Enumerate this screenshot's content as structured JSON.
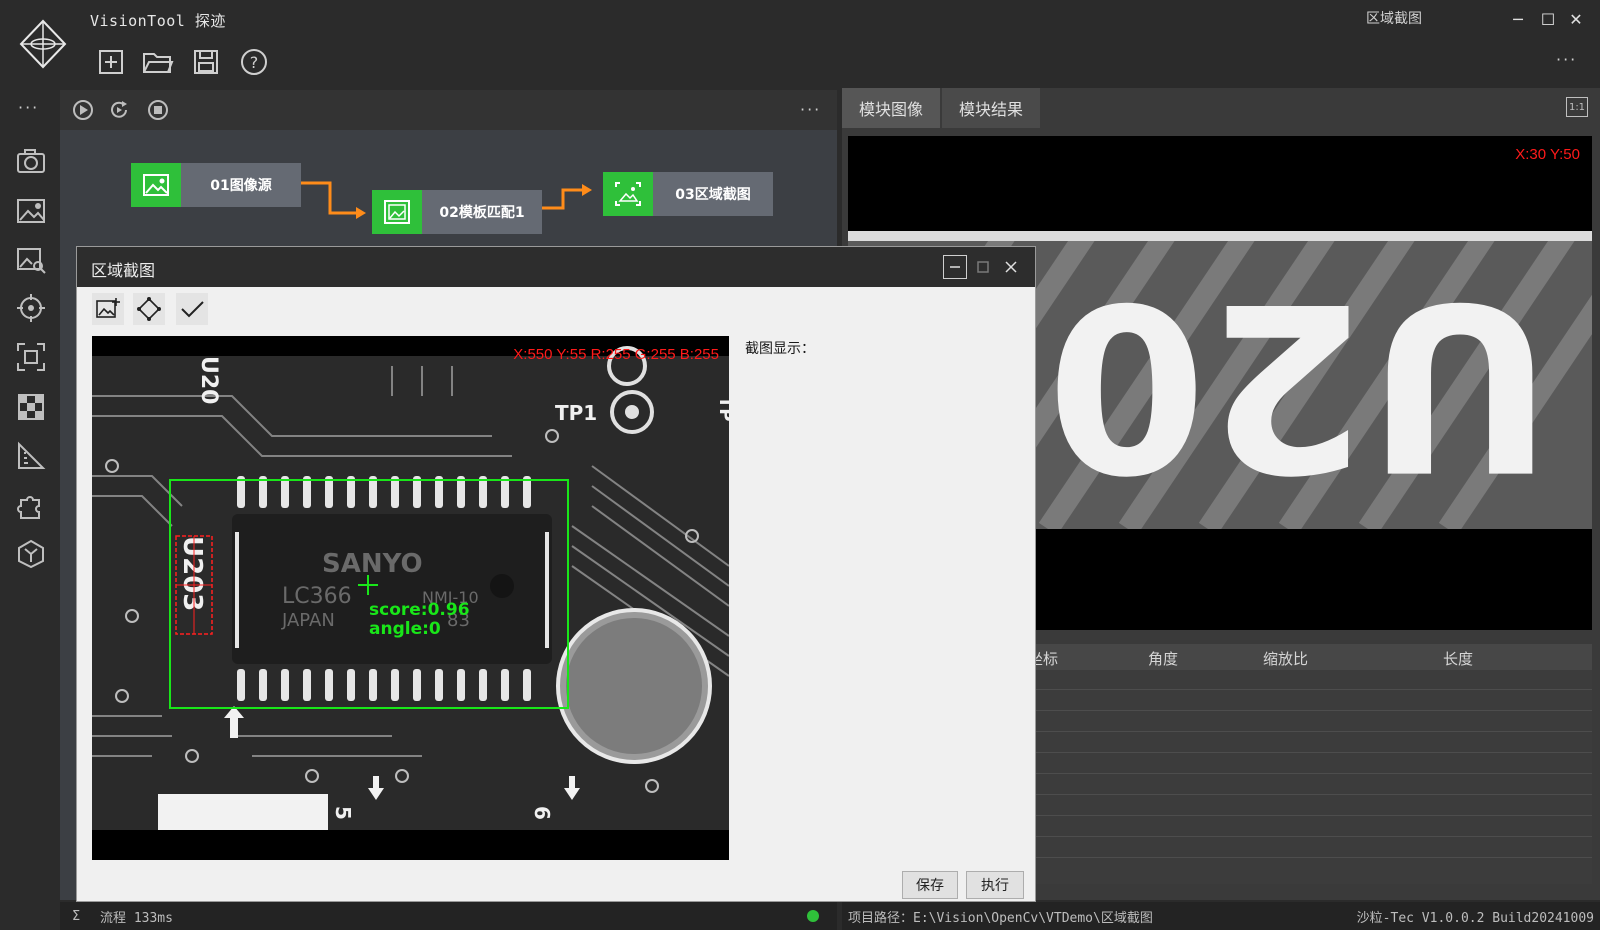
{
  "app": {
    "title": "VisionTool 探迹",
    "window_title": "区域截图",
    "minimize_glyph": "─",
    "maximize_glyph": "☐",
    "close_glyph": "✕",
    "more_glyph": "···"
  },
  "toolbar": {
    "icons": [
      "new-file-icon",
      "open-folder-icon",
      "save-icon",
      "help-icon"
    ]
  },
  "sidebar": {
    "more_glyph": "···",
    "icons": [
      "camera-icon",
      "image-settings-icon",
      "image-search-icon",
      "target-icon",
      "focus-icon",
      "checkerboard-icon",
      "measure-icon",
      "plugin-icon",
      "cube-icon"
    ]
  },
  "flow": {
    "more_glyph": "···",
    "nodes": [
      {
        "label": "01图像源"
      },
      {
        "label": "02模板匹配1"
      },
      {
        "label": "03区域截图"
      }
    ]
  },
  "right_panel": {
    "tabs": [
      {
        "label": "模块图像",
        "active": true
      },
      {
        "label": "模块结果",
        "active": false
      }
    ],
    "coord_readout": "X:30 Y:50",
    "zoom_label": "1:1",
    "result_columns": [
      "坐标",
      "角度",
      "缩放比",
      "长度"
    ],
    "crop_text": "U203"
  },
  "dialog": {
    "title": "区域截图",
    "pixel_readout": "X:550 Y:55  R:255 G:255 B:255",
    "crop_display_label": "截图显示：",
    "save_label": "保存",
    "execute_label": "执行",
    "overlay": {
      "score": "score:0.96",
      "angle": "angle:0",
      "chip_brand": "SANYO",
      "chip_model": "LC366",
      "chip_origin": "JAPAN",
      "chip_ref": "U203",
      "chip_suffix": "NMI-10",
      "chip_code": "83",
      "pcb_label_tp1": "TP1",
      "pcb_label_u20": "U20",
      "pcb_label_tp": "TP",
      "pcb_label_5": "5",
      "pcb_label_6": "6"
    }
  },
  "status_bar": {
    "sigma": "Σ",
    "flow_time": "流程 133ms",
    "project_path": "项目路径：E:\\Vision\\OpenCv\\VTDemo\\区域截图",
    "version": "沙粒-Tec V1.0.0.2 Build20241009"
  },
  "colors": {
    "accent_green": "#2fc03a",
    "flow_arrow": "#ff8c1a",
    "readout_red": "#ff1a1a",
    "match_box": "#19e619"
  }
}
